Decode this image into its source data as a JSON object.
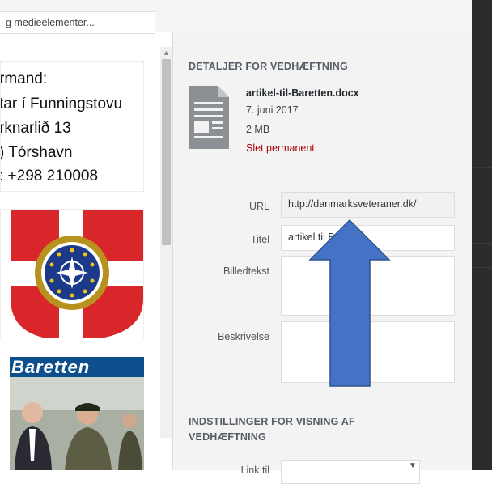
{
  "search": {
    "value": "g medieelementer..."
  },
  "thumbnails": {
    "text_lines": [
      "rmand:",
      "tar í Funningstovu",
      "rknarlið 13",
      ") Tórshavn",
      ": +298 210008"
    ],
    "photo_title": "Baretten"
  },
  "details": {
    "heading": "DETALJER FOR VEDHÆFTNING",
    "filename": "artikel-til-Baretten.docx",
    "date": "7. juni 2017",
    "size": "2 MB",
    "delete_label": "Slet permanent"
  },
  "form": {
    "url_label": "URL",
    "url_value": "http://danmarksveteraner.dk/",
    "title_label": "Titel",
    "title_value": "artikel til Baretten",
    "caption_label": "Billedtekst",
    "description_label": "Beskrivelse"
  },
  "display_settings": {
    "heading_line1": "INDSTILLINGER FOR VISNING AF",
    "heading_line2": "VEDHÆFTNING",
    "link_label": "Link til"
  },
  "annotation": {
    "arrow_color": "#4472c4",
    "arrow_stroke": "#2f528f"
  },
  "colors": {
    "danger": "#aa0000",
    "panel_bg": "#f3f3f3"
  }
}
